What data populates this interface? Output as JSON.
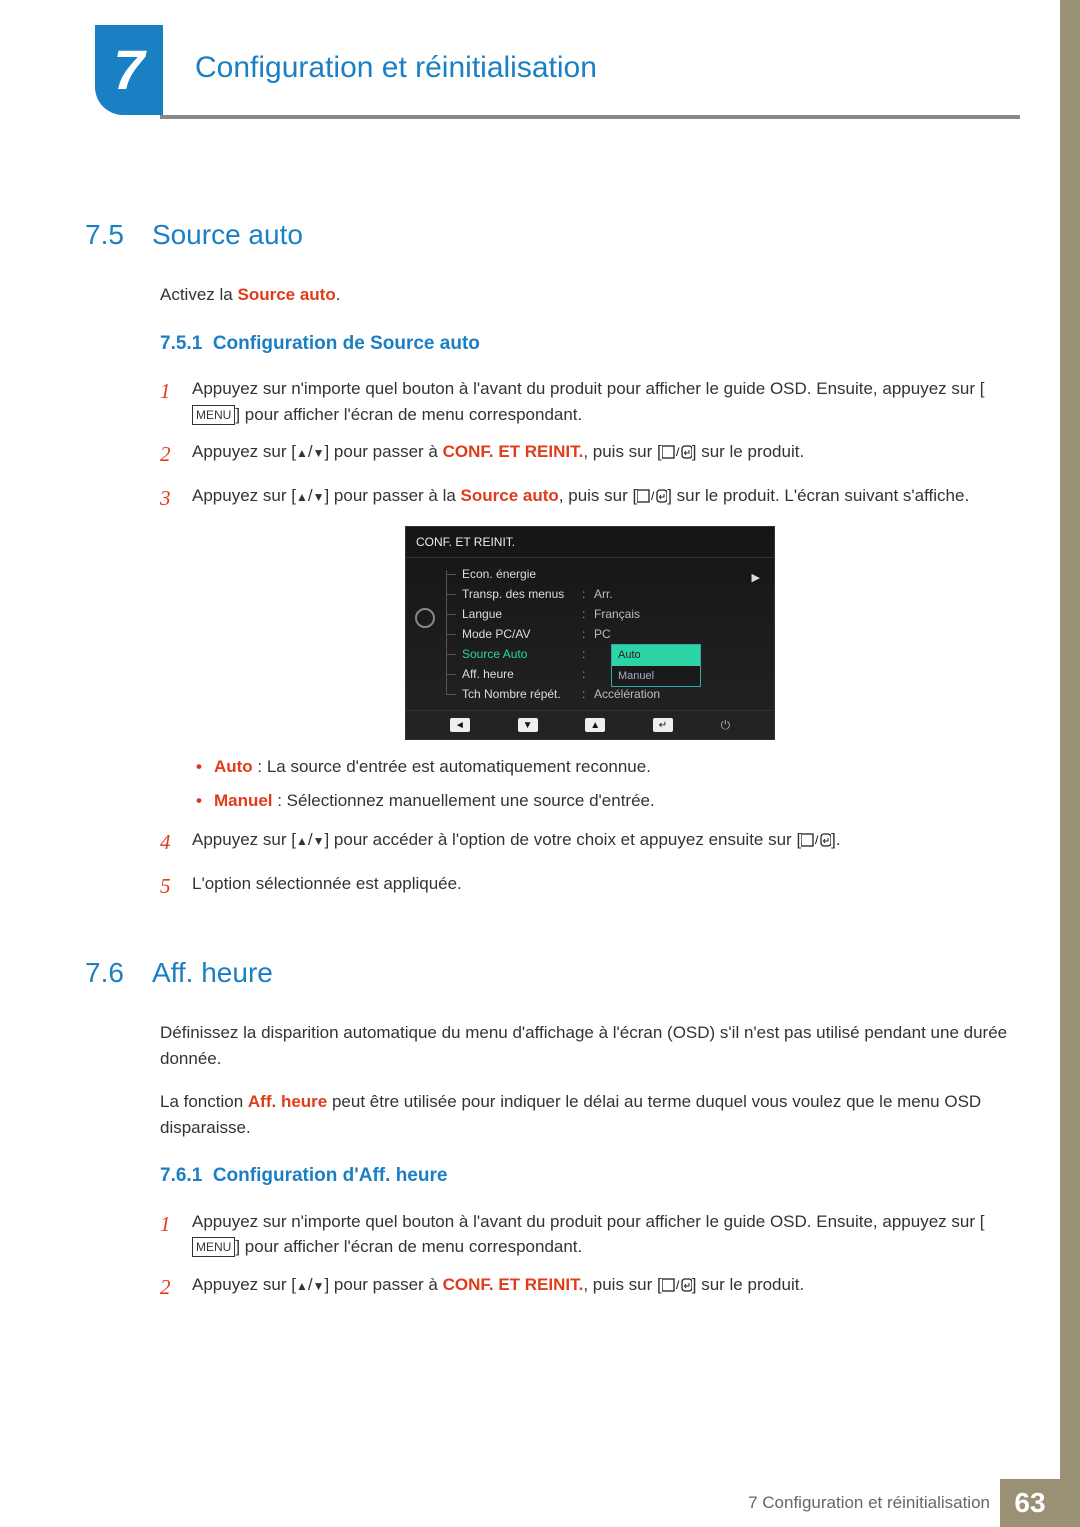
{
  "chapter": {
    "number": "7",
    "title": "Configuration et réinitialisation"
  },
  "section75": {
    "num": "7.5",
    "title": "Source auto",
    "intro_prefix": "Activez la ",
    "intro_term": "Source auto",
    "intro_suffix": ".",
    "sub": {
      "num": "7.5.1",
      "title": "Configuration de Source auto"
    },
    "steps": {
      "s1a": "Appuyez sur n'importe quel bouton à l'avant du produit pour afficher le guide OSD. Ensuite, appuyez sur [",
      "s1_menu": "MENU",
      "s1b": "] pour afficher l'écran de menu correspondant.",
      "s2a": "Appuyez sur [",
      "s2b": "] pour passer à ",
      "s2_term": "CONF. ET REINIT.",
      "s2c": ", puis sur [",
      "s2d": "] sur le produit.",
      "s3a": "Appuyez sur [",
      "s3b": "] pour passer à la ",
      "s3_term": "Source auto",
      "s3c": ", puis sur [",
      "s3d": "] sur le produit. L'écran suivant s'affiche.",
      "s4a": "Appuyez sur [",
      "s4b": "] pour accéder à l'option de votre choix et appuyez ensuite sur [",
      "s4c": "].",
      "s5": "L'option sélectionnée est appliquée."
    },
    "bullets": {
      "b1_term": "Auto",
      "b1_text": " : La source d'entrée est automatiquement reconnue.",
      "b2_term": "Manuel",
      "b2_text": " : Sélectionnez manuellement une source d'entrée."
    }
  },
  "osd": {
    "title": "CONF. ET REINIT.",
    "rows": [
      {
        "label": "Econ. énergie",
        "value": ""
      },
      {
        "label": "Transp. des menus",
        "value": "Arr."
      },
      {
        "label": "Langue",
        "value": "Français"
      },
      {
        "label": "Mode PC/AV",
        "value": "PC"
      },
      {
        "label": "Source Auto",
        "value": "",
        "highlight": true
      },
      {
        "label": "Aff. heure",
        "value": ""
      },
      {
        "label": "Tch Nombre répét.",
        "value": "Accélération"
      }
    ],
    "dropdown": {
      "selected": "Auto",
      "other": "Manuel"
    }
  },
  "section76": {
    "num": "7.6",
    "title": "Aff. heure",
    "p1": "Définissez la disparition automatique du menu d'affichage à l'écran (OSD) s'il n'est pas utilisé pendant une durée donnée.",
    "p2a": "La fonction ",
    "p2_term": "Aff. heure",
    "p2b": " peut être utilisée pour indiquer le délai au terme duquel vous voulez que le menu OSD disparaisse.",
    "sub": {
      "num": "7.6.1",
      "title": "Configuration d'Aff. heure"
    },
    "steps": {
      "s1a": "Appuyez sur n'importe quel bouton à l'avant du produit pour afficher le guide OSD. Ensuite, appuyez sur [",
      "s1_menu": "MENU",
      "s1b": "] pour afficher l'écran de menu correspondant.",
      "s2a": "Appuyez sur [",
      "s2b": "] pour passer à ",
      "s2_term": "CONF. ET REINIT.",
      "s2c": ", puis sur [",
      "s2d": "] sur le produit."
    }
  },
  "footer": {
    "text": "7 Configuration et réinitialisation",
    "page": "63"
  },
  "glyphs": {
    "up": "▲",
    "down": "▼",
    "slash": "/"
  }
}
